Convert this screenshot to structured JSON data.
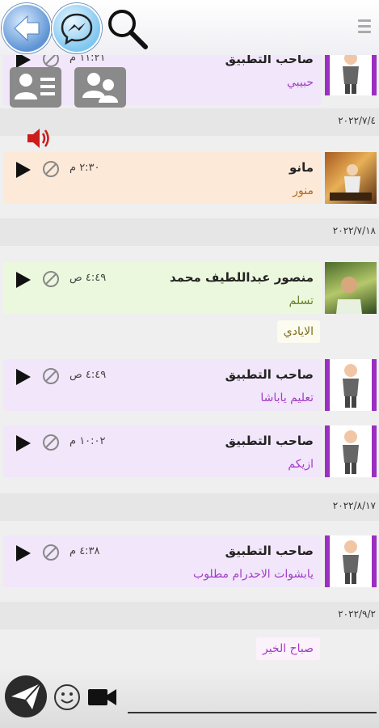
{
  "icons": {
    "back": "back-arrow-icon",
    "messenger": "messenger-icon",
    "search": "search-icon",
    "menu": "menu-icon",
    "single_user": "user-list-icon",
    "group": "group-icon",
    "speaker": "speaker-icon",
    "send": "send-icon",
    "emoji": "smiley-icon",
    "video": "video-camera-icon"
  },
  "messages": [
    {
      "sender": "صاحب التطبيق",
      "text": "حبيبي",
      "time": "١١:٢١ م"
    },
    {
      "sender": "مانو",
      "text": "منور",
      "time": "٢:٣٠ م"
    },
    {
      "sender": "منصور عبداللطيف محمد",
      "text": "تسلم",
      "time": "٤:٤٩ ص"
    },
    {
      "sender": "صاحب التطبيق",
      "text": "تعليم ياباشا",
      "time": "٤:٤٩ ص"
    },
    {
      "sender": "صاحب التطبيق",
      "text": "ازيكم",
      "time": "١٠:٠٢ م"
    },
    {
      "sender": "صاحب التطبيق",
      "text": "يابشوات الاحدرام مطلوب",
      "time": "٤:٣٨ م"
    }
  ],
  "dates": [
    "٢٠٢٢/٧/٤",
    "٢٠٢٢/٧/١٨",
    "٢٠٢٢/٨/١٧",
    "٢٠٢٢/٩/٢"
  ],
  "bubbles": {
    "reply1": "الايادي",
    "reply2": "صباح الخير"
  },
  "composer": {
    "placeholder": ""
  }
}
